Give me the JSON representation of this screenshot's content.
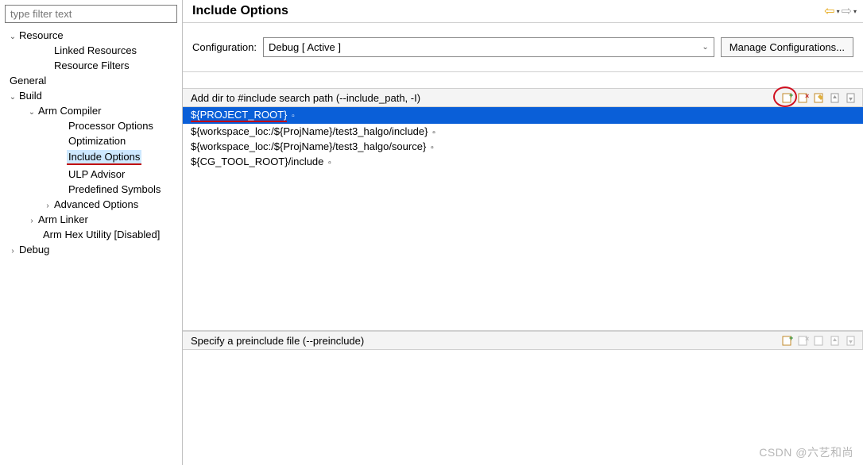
{
  "sidebar": {
    "filter_placeholder": "type filter text",
    "items": [
      {
        "label": "Resource",
        "indent": 0,
        "expanded": true,
        "hasChildren": true
      },
      {
        "label": "Linked Resources",
        "indent": 2,
        "hasChildren": false
      },
      {
        "label": "Resource Filters",
        "indent": 2,
        "hasChildren": false
      },
      {
        "label": "General",
        "indent": 0,
        "hasChildren": false,
        "noChev": true
      },
      {
        "label": "Build",
        "indent": 0,
        "expanded": true,
        "hasChildren": true
      },
      {
        "label": "Arm Compiler",
        "indent": 1,
        "expanded": true,
        "hasChildren": true
      },
      {
        "label": "Processor Options",
        "indent": 3,
        "hasChildren": false
      },
      {
        "label": "Optimization",
        "indent": 3,
        "hasChildren": false
      },
      {
        "label": "Include Options",
        "indent": 3,
        "hasChildren": false,
        "selected": true,
        "redUnderline": true
      },
      {
        "label": "ULP Advisor",
        "indent": 3,
        "hasChildren": false
      },
      {
        "label": "Predefined Symbols",
        "indent": 3,
        "hasChildren": false
      },
      {
        "label": "Advanced Options",
        "indent": 2,
        "expanded": false,
        "hasChildren": true
      },
      {
        "label": "Arm Linker",
        "indent": 1,
        "expanded": false,
        "hasChildren": true
      },
      {
        "label": "Arm Hex Utility  [Disabled]",
        "indent": 1,
        "hasChildren": false,
        "noChev": true,
        "extraIndent": true
      },
      {
        "label": "Debug",
        "indent": 0,
        "expanded": false,
        "hasChildren": true
      }
    ]
  },
  "header": {
    "title": "Include Options"
  },
  "config": {
    "label": "Configuration:",
    "value": "Debug  [ Active ]",
    "manage_label": "Manage Configurations..."
  },
  "section_include": {
    "title": "Add dir to #include search path (--include_path, -I)",
    "rows": [
      {
        "text": "${PROJECT_ROOT}",
        "selected": true,
        "redUnderline": true
      },
      {
        "text": "${workspace_loc:/${ProjName}/test3_halgo/include}"
      },
      {
        "text": "${workspace_loc:/${ProjName}/test3_halgo/source}"
      },
      {
        "text": "${CG_TOOL_ROOT}/include"
      }
    ]
  },
  "section_preinclude": {
    "title": "Specify a preinclude file (--preinclude)"
  },
  "watermark": "CSDN @六艺和尚"
}
